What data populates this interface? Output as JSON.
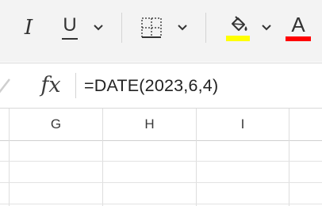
{
  "ribbon": {
    "italic_label": "I",
    "underline_label": "U",
    "font_color_label": "A",
    "fill_color": "#ffff00",
    "font_color": "#ff0000"
  },
  "formula_bar": {
    "fx_label": "fx",
    "formula": "=DATE(2023,6,4)"
  },
  "grid": {
    "columns": [
      "G",
      "H",
      "I"
    ]
  }
}
